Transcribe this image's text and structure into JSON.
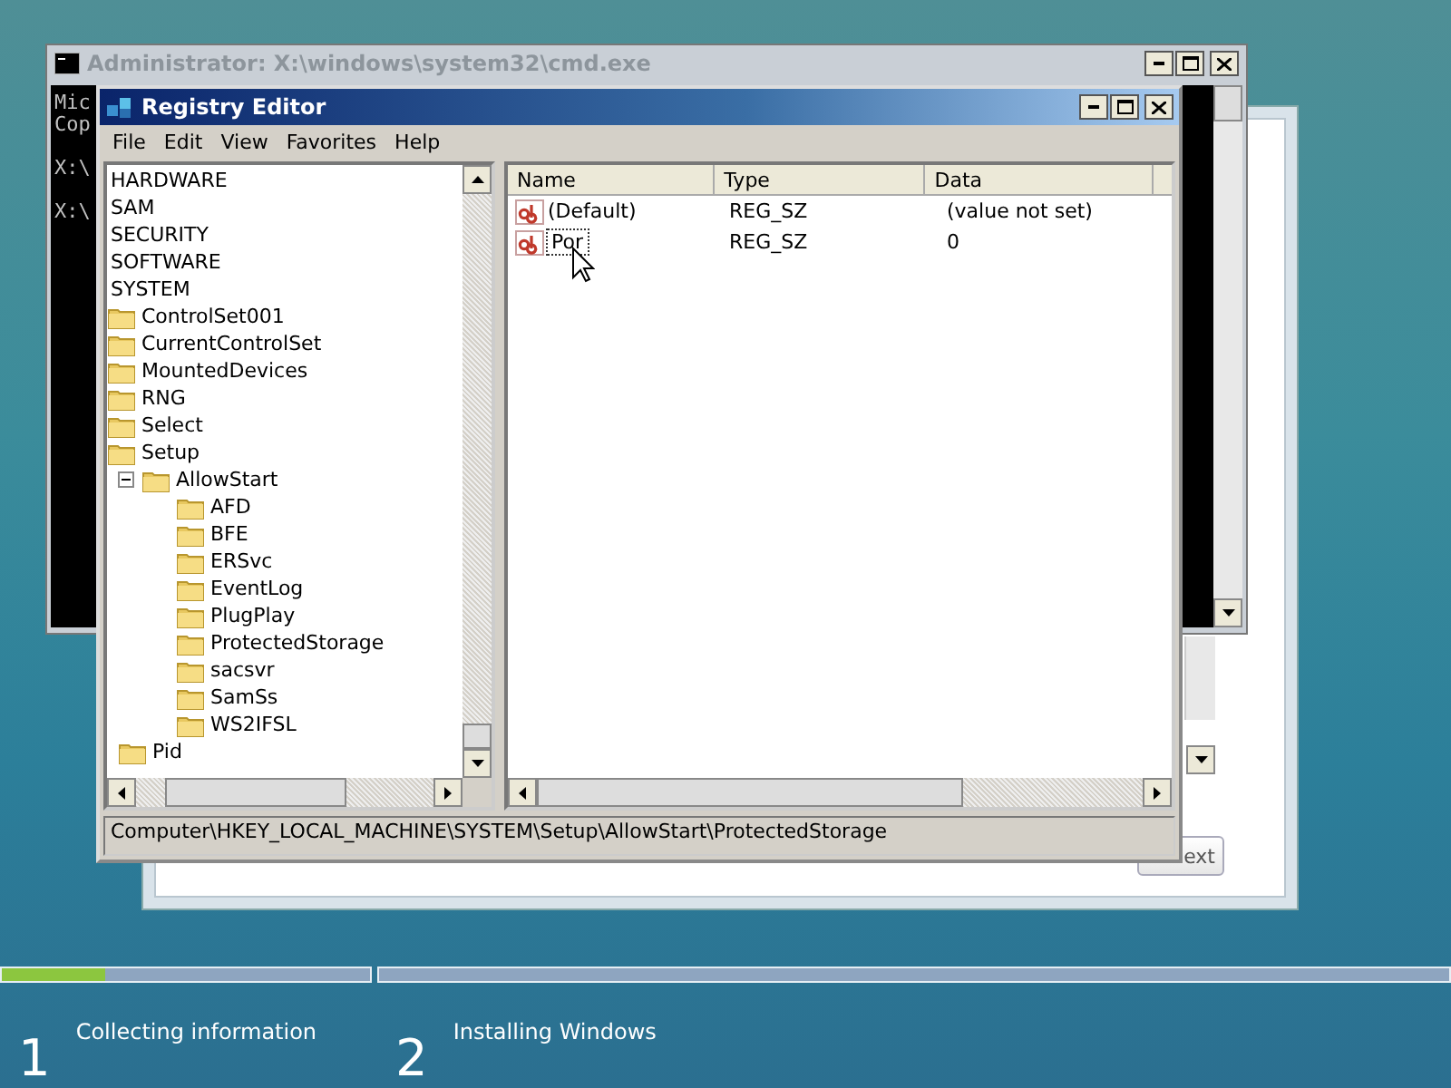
{
  "setup_window": {
    "next_button": "ext"
  },
  "cmd_window": {
    "title": "Administrator: X:\\windows\\system32\\cmd.exe",
    "lines": [
      "Mic",
      "Cop",
      "X:\\",
      "X:\\"
    ]
  },
  "registry_editor": {
    "title": "Registry Editor",
    "menu": [
      "File",
      "Edit",
      "View",
      "Favorites",
      "Help"
    ],
    "tree": [
      {
        "label": "HARDWARE"
      },
      {
        "label": "SAM"
      },
      {
        "label": "SECURITY"
      },
      {
        "label": "SOFTWARE"
      },
      {
        "label": "SYSTEM",
        "children": [
          {
            "label": "ControlSet001"
          },
          {
            "label": "CurrentControlSet"
          },
          {
            "label": "MountedDevices"
          },
          {
            "label": "RNG"
          },
          {
            "label": "Select"
          },
          {
            "label": "Setup",
            "children": [
              {
                "label": "AllowStart",
                "children": [
                  {
                    "label": "AFD"
                  },
                  {
                    "label": "BFE"
                  },
                  {
                    "label": "ERSvc"
                  },
                  {
                    "label": "EventLog"
                  },
                  {
                    "label": "PlugPlay"
                  },
                  {
                    "label": "ProtectedStorage"
                  },
                  {
                    "label": "sacsvr"
                  },
                  {
                    "label": "SamSs"
                  },
                  {
                    "label": "WS2IFSL"
                  }
                ]
              },
              {
                "label": "Pid"
              }
            ]
          }
        ]
      }
    ],
    "columns": [
      "Name",
      "Type",
      "Data"
    ],
    "rows": [
      {
        "name": "(Default)",
        "type": "REG_SZ",
        "data": "(value not set)",
        "editing": false
      },
      {
        "name": "Por",
        "type": "REG_SZ",
        "data": "0",
        "editing": true
      }
    ],
    "status_bar": "Computer\\HKEY_LOCAL_MACHINE\\SYSTEM\\Setup\\AllowStart\\ProtectedStorage"
  },
  "steps": [
    {
      "number": "1",
      "label": "Collecting information",
      "level": 0.28
    },
    {
      "number": "2",
      "label": "Installing Windows",
      "level": 0
    }
  ]
}
